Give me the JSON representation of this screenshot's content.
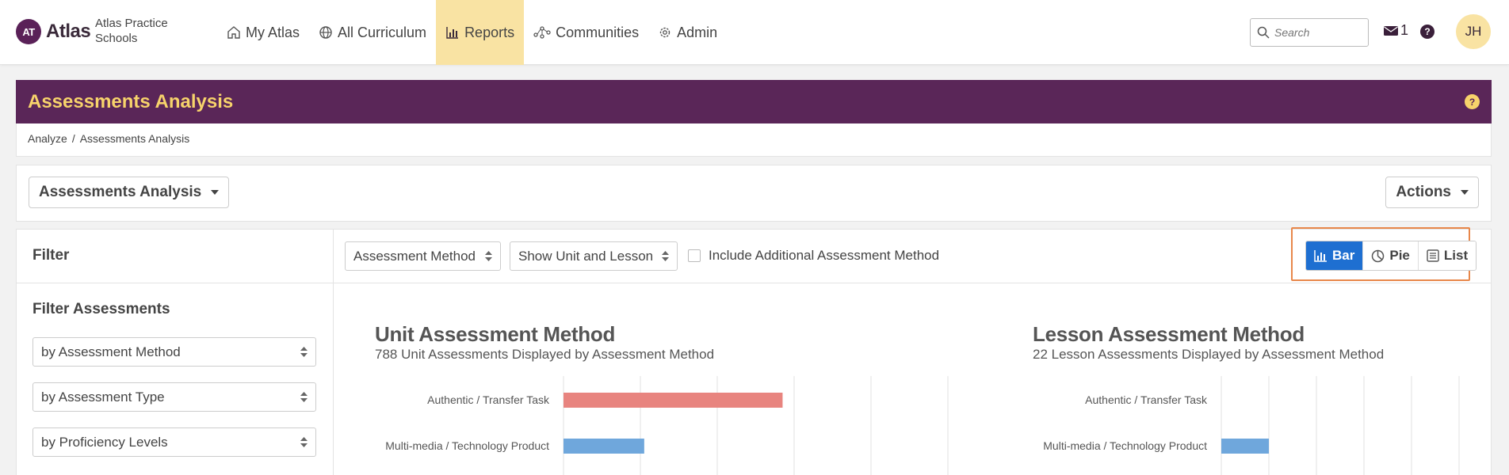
{
  "brand": {
    "logo_mark": "AT",
    "logo_word": "Atlas",
    "school": "Atlas Practice Schools"
  },
  "nav": {
    "items": [
      {
        "label": "My Atlas",
        "icon": "home-icon"
      },
      {
        "label": "All Curriculum",
        "icon": "globe-icon"
      },
      {
        "label": "Reports",
        "icon": "bar-chart-icon",
        "active": true
      },
      {
        "label": "Communities",
        "icon": "network-icon"
      },
      {
        "label": "Admin",
        "icon": "gear-icon"
      }
    ],
    "active_color": "#f9e3a3"
  },
  "search": {
    "placeholder": "Search"
  },
  "mail": {
    "count": "1"
  },
  "help_symbol": "?",
  "user": {
    "initials": "JH"
  },
  "page": {
    "title": "Assessments Analysis",
    "banner_color": "#5a2658",
    "title_color": "#f7d36b",
    "breadcrumb": [
      "Analyze",
      "Assessments Analysis"
    ]
  },
  "toolbar": {
    "report_select": "Assessments Analysis",
    "actions_label": "Actions"
  },
  "filter": {
    "title": "Filter",
    "subtitle": "Filter Assessments",
    "selects": [
      "by Assessment Method",
      "by Assessment Type",
      "by Proficiency Levels"
    ]
  },
  "controls": {
    "group_by": "Assessment Method",
    "show": "Show Unit and Lesson",
    "include_label": "Include Additional Assessment Method",
    "views": [
      {
        "label": "Bar",
        "icon": "bar-chart-icon",
        "active": true
      },
      {
        "label": "Pie",
        "icon": "pie-chart-icon",
        "active": false
      },
      {
        "label": "List",
        "icon": "list-icon",
        "active": false
      }
    ],
    "active_color": "#1e6fd1"
  },
  "chart_data": [
    {
      "type": "bar",
      "orientation": "horizontal",
      "title": "Unit Assessment Method",
      "subtitle": "788 Unit Assessments Displayed by Assessment Method",
      "categories": [
        "Authentic / Transfer Task",
        "Multi-media / Technology Product"
      ],
      "values": [
        57,
        21
      ],
      "colors": [
        "#e8847f",
        "#6fa7dc"
      ],
      "xlim": [
        0,
        100
      ],
      "grid": true
    },
    {
      "type": "bar",
      "orientation": "horizontal",
      "title": "Lesson Assessment Method",
      "subtitle": "22 Lesson Assessments Displayed by Assessment Method",
      "categories": [
        "Authentic / Transfer Task",
        "Multi-media / Technology Product"
      ],
      "values": [
        0,
        5
      ],
      "colors": [
        "#e8847f",
        "#6fa7dc"
      ],
      "xlim": [
        0,
        25
      ],
      "grid": true
    }
  ]
}
